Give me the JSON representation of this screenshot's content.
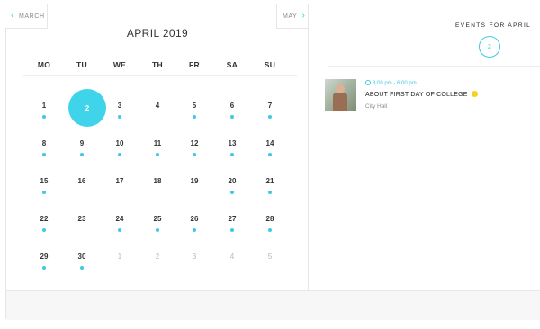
{
  "calendar": {
    "prev_label": "MARCH",
    "next_label": "MAY",
    "month_title": "APRIL 2019",
    "weekdays": [
      "MO",
      "TU",
      "WE",
      "TH",
      "FR",
      "SA",
      "SU"
    ],
    "weeks": [
      [
        {
          "n": "1",
          "dot": true
        },
        {
          "n": "2",
          "dot": false,
          "selected": true
        },
        {
          "n": "3",
          "dot": true
        },
        {
          "n": "4",
          "dot": false
        },
        {
          "n": "5",
          "dot": true
        },
        {
          "n": "6",
          "dot": true
        },
        {
          "n": "7",
          "dot": true
        }
      ],
      [
        {
          "n": "8",
          "dot": true
        },
        {
          "n": "9",
          "dot": true
        },
        {
          "n": "10",
          "dot": true
        },
        {
          "n": "11",
          "dot": true
        },
        {
          "n": "12",
          "dot": true
        },
        {
          "n": "13",
          "dot": true
        },
        {
          "n": "14",
          "dot": true
        }
      ],
      [
        {
          "n": "15",
          "dot": true
        },
        {
          "n": "16",
          "dot": false
        },
        {
          "n": "17",
          "dot": false
        },
        {
          "n": "18",
          "dot": false
        },
        {
          "n": "19",
          "dot": false
        },
        {
          "n": "20",
          "dot": true
        },
        {
          "n": "21",
          "dot": true
        }
      ],
      [
        {
          "n": "22",
          "dot": true
        },
        {
          "n": "23",
          "dot": false
        },
        {
          "n": "24",
          "dot": true
        },
        {
          "n": "25",
          "dot": true
        },
        {
          "n": "26",
          "dot": true
        },
        {
          "n": "27",
          "dot": true
        },
        {
          "n": "28",
          "dot": true
        }
      ],
      [
        {
          "n": "29",
          "dot": true
        },
        {
          "n": "30",
          "dot": true
        },
        {
          "n": "1",
          "dot": false,
          "muted": true
        },
        {
          "n": "2",
          "dot": false,
          "muted": true
        },
        {
          "n": "3",
          "dot": false,
          "muted": true
        },
        {
          "n": "4",
          "dot": false,
          "muted": true
        },
        {
          "n": "5",
          "dot": false,
          "muted": true
        }
      ]
    ]
  },
  "events_panel": {
    "header": "EVENTS FOR APRIL",
    "count": "2",
    "events": [
      {
        "time": "8:00 pm - 6:00 pm",
        "title": "ABOUT FIRST DAY OF COLLEGE",
        "location": "City Hall"
      }
    ]
  },
  "colors": {
    "accent": "#40c9e3",
    "selected": "#40d4ea",
    "event_dot": "#f6d21e"
  }
}
